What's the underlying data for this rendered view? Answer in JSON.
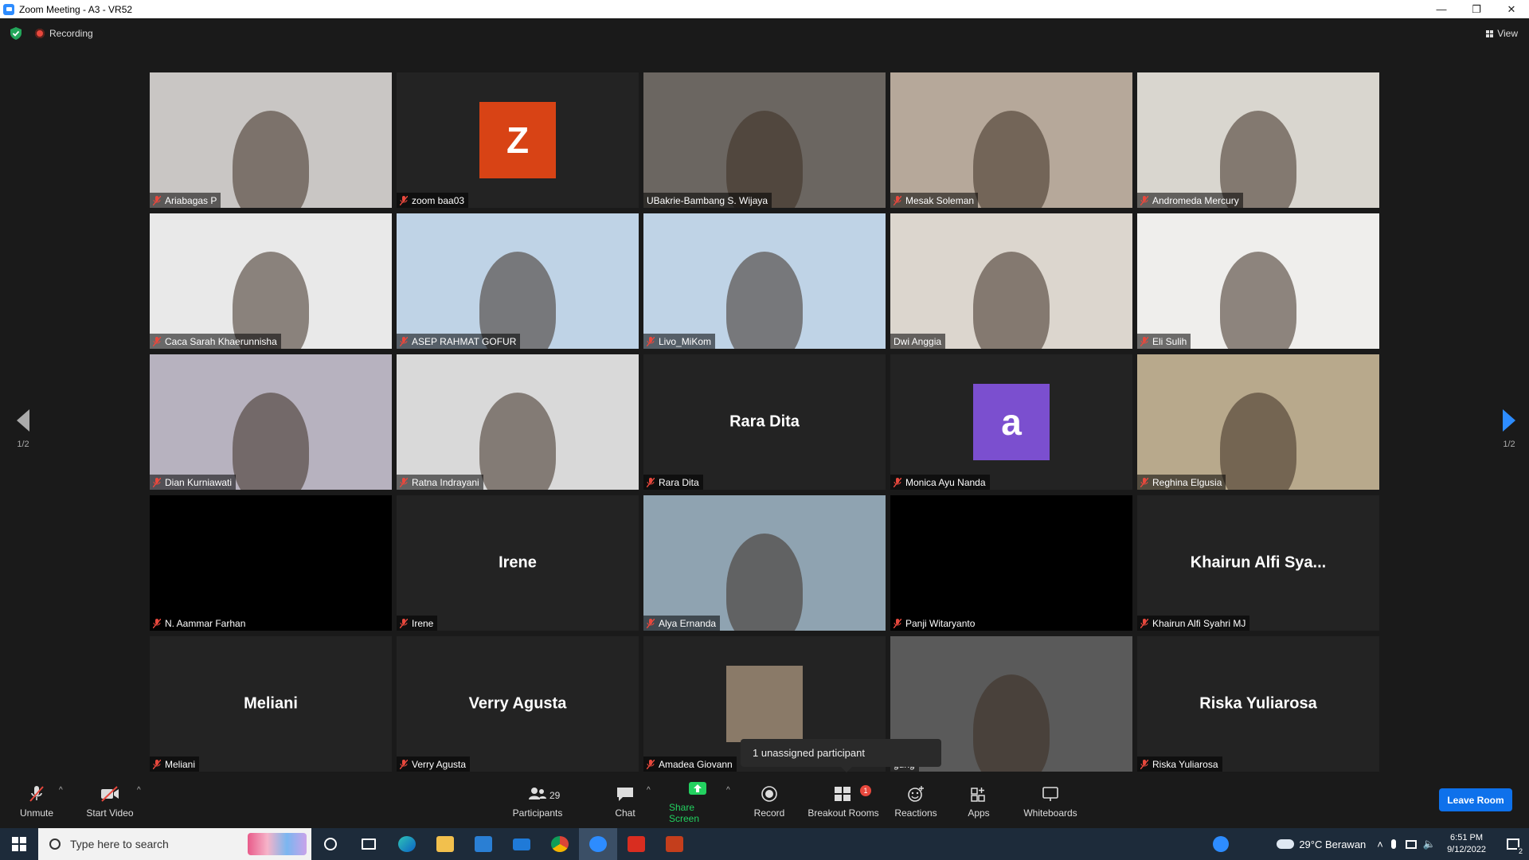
{
  "window": {
    "title": "Zoom Meeting - A3 - VR52",
    "minimize": "—",
    "restore": "❐",
    "close": "✕"
  },
  "status": {
    "recording": "Recording",
    "view": "View"
  },
  "tiles": [
    {
      "name": "Ariabagas P",
      "video": true,
      "muted": true,
      "bg": "#c9c6c4"
    },
    {
      "name": "zoom baa03",
      "video": false,
      "muted": true,
      "avatar_letter": "Z",
      "avatar_color": "#d84315"
    },
    {
      "name": "UBakrie-Bambang S. Wijaya",
      "video": true,
      "muted": false,
      "active": true,
      "bg": "#6b6661"
    },
    {
      "name": "Mesak Soleman",
      "video": true,
      "muted": true,
      "bg": "#b6a89a"
    },
    {
      "name": "Andromeda Mercury",
      "video": true,
      "muted": true,
      "bg": "#d9d6cf"
    },
    {
      "name": "Caca Sarah Khaerunnisha",
      "video": true,
      "muted": true,
      "bg": "#e9e9e9"
    },
    {
      "name": "ASEP RAHMAT GOFUR",
      "video": true,
      "muted": true,
      "bg": "#bfd3e6"
    },
    {
      "name": "Livo_MiKom",
      "video": true,
      "muted": true,
      "bg": "#bfd3e6"
    },
    {
      "name": "Dwi Anggia",
      "video": true,
      "muted": false,
      "bg": "#dcd6ce"
    },
    {
      "name": "Eli Sulih",
      "video": true,
      "muted": true,
      "bg": "#efeeec"
    },
    {
      "name": "Dian Kurniawati",
      "video": true,
      "muted": true,
      "bg": "#b7b2bf"
    },
    {
      "name": "Ratna Indrayani",
      "video": true,
      "muted": true,
      "bg": "#d9d9d9"
    },
    {
      "name": "Rara Dita",
      "video": false,
      "muted": true,
      "big_name": "Rara Dita"
    },
    {
      "name": "Monica Ayu Nanda",
      "video": false,
      "muted": true,
      "avatar_letter": "a",
      "avatar_color": "#7b4fcf"
    },
    {
      "name": "Reghina Elgusia",
      "video": true,
      "muted": true,
      "bg": "#b8a98c"
    },
    {
      "name": "N. Aammar Farhan",
      "video": true,
      "muted": true,
      "bg": "#000000"
    },
    {
      "name": "Irene",
      "video": false,
      "muted": true,
      "big_name": "Irene"
    },
    {
      "name": "Alya Ernanda",
      "video": true,
      "muted": true,
      "bg": "#8fa3b1"
    },
    {
      "name": "Panji Witaryanto",
      "video": true,
      "muted": true,
      "bg": "#000000"
    },
    {
      "name": "Khairun Alfi Syahri MJ",
      "video": false,
      "muted": true,
      "big_name": "Khairun Alfi Sya..."
    },
    {
      "name": "Meliani",
      "video": false,
      "muted": true,
      "big_name": "Meliani"
    },
    {
      "name": "Verry Agusta",
      "video": false,
      "muted": true,
      "big_name": "Verry Agusta"
    },
    {
      "name": "Amadea Giovann",
      "video": false,
      "muted": true,
      "thumb": true,
      "bg": "#8a7a68"
    },
    {
      "name": "gung",
      "video": true,
      "muted": false,
      "bg": "#5a5a5a"
    },
    {
      "name": "Riska Yuliarosa",
      "video": false,
      "muted": true,
      "big_name": "Riska Yuliarosa"
    }
  ],
  "pager": {
    "left": "1/2",
    "right": "1/2"
  },
  "tooltip": "1 unassigned participant",
  "toolbar": {
    "unmute": "Unmute",
    "start_video": "Start Video",
    "participants": "Participants",
    "participants_count": "29",
    "chat": "Chat",
    "share_screen": "Share Screen",
    "record": "Record",
    "breakout_rooms": "Breakout Rooms",
    "breakout_badge": "1",
    "reactions": "Reactions",
    "apps": "Apps",
    "whiteboards": "Whiteboards",
    "leave": "Leave Room",
    "caret": "^"
  },
  "taskbar": {
    "search_placeholder": "Type here to search",
    "weather": "29°C  Berawan",
    "time": "6:51 PM",
    "date": "9/12/2022",
    "notif_count": "2"
  }
}
